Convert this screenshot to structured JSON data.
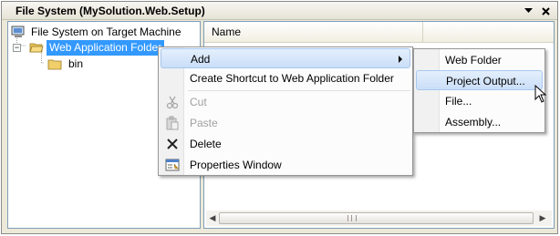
{
  "window": {
    "title": "File System (MySolution.Web.Setup)"
  },
  "tree": {
    "root_label": "File System on Target Machine",
    "selected_label": "Web Application Folder",
    "child_label": "bin"
  },
  "list": {
    "column_name": "Name"
  },
  "context_menu": {
    "items": [
      {
        "label": "Add",
        "enabled": true,
        "has_submenu": true,
        "icon": ""
      },
      {
        "label": "Create Shortcut to Web Application Folder",
        "enabled": true,
        "icon": ""
      },
      {
        "label": "Cut",
        "enabled": false,
        "icon": "scissors-icon"
      },
      {
        "label": "Paste",
        "enabled": false,
        "icon": "paste-icon"
      },
      {
        "label": "Delete",
        "enabled": true,
        "icon": "delete-x-icon"
      },
      {
        "label": "Properties Window",
        "enabled": true,
        "icon": "properties-window-icon"
      }
    ]
  },
  "submenu": {
    "items": [
      {
        "label": "Web Folder"
      },
      {
        "label": "Project Output..."
      },
      {
        "label": "File..."
      },
      {
        "label": "Assembly..."
      }
    ]
  },
  "colors": {
    "selection": "#3399ff",
    "menu_highlight": "#cadef8",
    "pane_border": "#7f9db9"
  }
}
